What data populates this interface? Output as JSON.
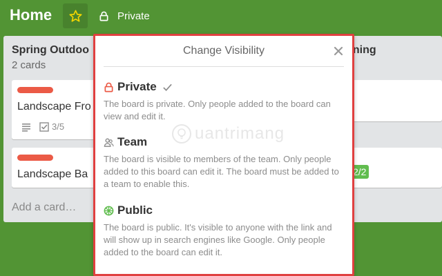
{
  "header": {
    "board_title": "Home",
    "visibility_label": "Private",
    "star_color": "#f2d600"
  },
  "lists": [
    {
      "title": "Spring Outdoo",
      "count": "2 cards",
      "cards": [
        {
          "title": "Landscape Fro",
          "label_color": "#eb5a46",
          "checklist": "3/5"
        },
        {
          "title": "Landscape Ba",
          "label_color": "#eb5a46"
        }
      ],
      "add_card": "Add a card…"
    },
    {
      "title": "aning",
      "badge": "2/2"
    }
  ],
  "popover": {
    "title": "Change Visibility",
    "options": [
      {
        "label": "Private",
        "icon": "lock-icon",
        "icon_color": "#eb5a46",
        "selected": true,
        "description": "The board is private. Only people added to the board can view and edit it."
      },
      {
        "label": "Team",
        "icon": "team-icon",
        "icon_color": "#8c8c8c",
        "selected": false,
        "description": "The board is visible to members of the team. Only people added to this board can edit it. The board must be added to a team to enable this."
      },
      {
        "label": "Public",
        "icon": "globe-icon",
        "icon_color": "#61bd4f",
        "selected": false,
        "description": "The board is public. It's visible to anyone with the link and will show up in search engines like Google. Only people added to the board can edit it."
      }
    ]
  },
  "watermark": "uantrimang"
}
